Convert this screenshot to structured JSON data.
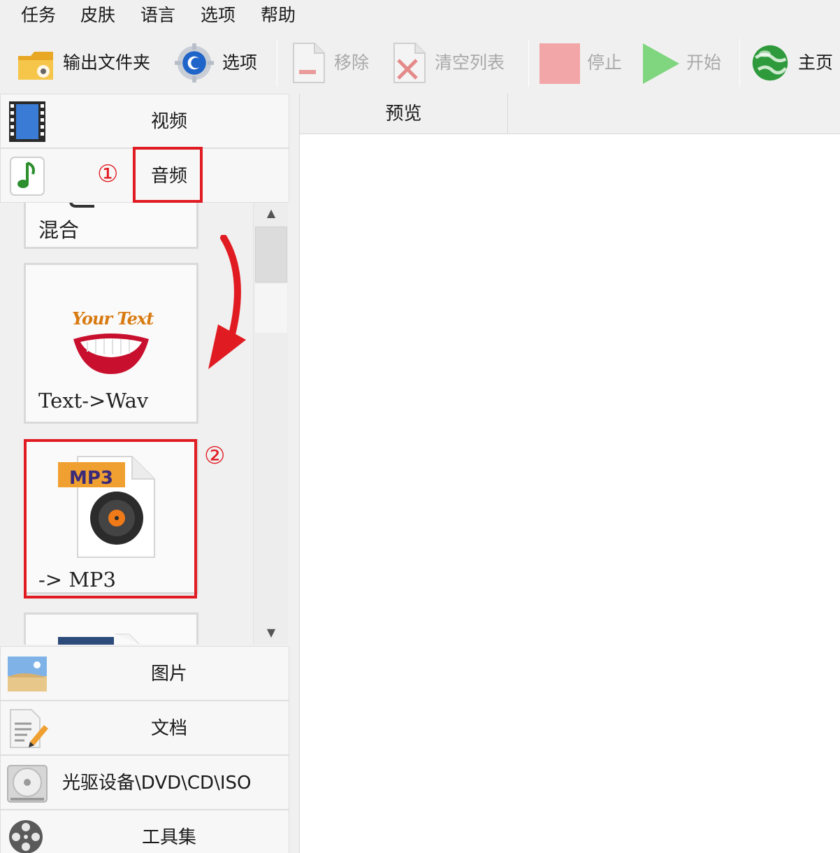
{
  "menu": {
    "items": [
      "任务",
      "皮肤",
      "语言",
      "选项",
      "帮助"
    ]
  },
  "toolbar": {
    "output_folder": "输出文件夹",
    "options": "选项",
    "remove": "移除",
    "clear_list": "清空列表",
    "stop": "停止",
    "start": "开始",
    "home": "主页"
  },
  "categories": {
    "video": "视频",
    "audio": "音频",
    "image": "图片",
    "document": "文档",
    "disc": "光驱设备\\DVD\\CD\\ISO",
    "tools": "工具集"
  },
  "audio_tools": [
    {
      "label": "混合"
    },
    {
      "label": "Text->Wav",
      "art_text": "Your Text"
    },
    {
      "label": "-> MP3",
      "badge": "MP3"
    }
  ],
  "annotations": {
    "step1": "①",
    "step2": "②"
  },
  "preview": {
    "tab_label": "预览"
  },
  "colors": {
    "highlight": "#e11b22",
    "stop": "#f2a6a8",
    "start": "#7fd67f",
    "mp3_badge": "#f0a030"
  }
}
